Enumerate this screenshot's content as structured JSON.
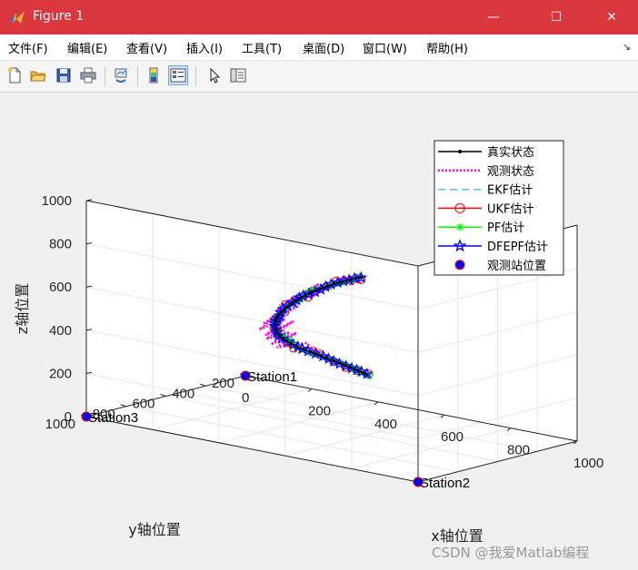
{
  "window": {
    "title": "Figure 1",
    "controls": {
      "minimize": "—",
      "maximize": "☐",
      "close": "✕"
    }
  },
  "menu": {
    "items": [
      "文件(F)",
      "编辑(E)",
      "查看(V)",
      "插入(I)",
      "工具(T)",
      "桌面(D)",
      "窗口(W)",
      "帮助(H)"
    ],
    "overflow": "↘"
  },
  "toolbar": {
    "buttons": [
      "new-figure",
      "open-file",
      "save-figure",
      "print-figure",
      "link-plot",
      "insert-colorbar",
      "insert-legend",
      "edit-plot",
      "open-property-inspector"
    ],
    "active": "insert-legend"
  },
  "colors": {
    "titlebar": "#d9363e",
    "truth": "#000000",
    "observation": "#ff00ff",
    "ekf": "#4dbeee",
    "ukf": "#ff0000",
    "pf": "#00ff00",
    "dfepf": "#0000ff",
    "station": "#0000ff",
    "station_edge": "#ff0000"
  },
  "chart_data": {
    "type": "line",
    "projection": "3d",
    "xlabel": "x轴位置",
    "ylabel": "y轴位置",
    "zlabel": "z轴位置",
    "xlim": [
      0,
      1000
    ],
    "ylim": [
      200,
      1000
    ],
    "zlim": [
      0,
      1000
    ],
    "xticks": [
      "0",
      "200",
      "400",
      "600",
      "800",
      "1000"
    ],
    "yticks": [
      "200",
      "400",
      "600",
      "800",
      "1000"
    ],
    "zticks": [
      "0",
      "200",
      "400",
      "600",
      "800",
      "1000"
    ],
    "grid": true,
    "legend_position": "top-right",
    "legend": [
      {
        "label": "真实状态",
        "color": "#000000",
        "style": "solid",
        "marker": "dot"
      },
      {
        "label": "观测状态",
        "color": "#ff00ff",
        "style": "dotted",
        "marker": "none"
      },
      {
        "label": "EKF估计",
        "color": "#4dbeee",
        "style": "dashed",
        "marker": "none"
      },
      {
        "label": "UKF估计",
        "color": "#ff0000",
        "style": "solid",
        "marker": "circle"
      },
      {
        "label": "PF估计",
        "color": "#00ff00",
        "style": "solid",
        "marker": "star"
      },
      {
        "label": "DFEPF估计",
        "color": "#0000ff",
        "style": "solid",
        "marker": "pentagram"
      },
      {
        "label": "观测站位置",
        "color": "#0000ff",
        "style": "none",
        "marker": "filled-circle"
      }
    ],
    "stations": [
      {
        "label": "Station1",
        "x": 0,
        "y": 200,
        "z": 0
      },
      {
        "label": "Station2",
        "x": 1000,
        "y": 1000,
        "z": 0
      },
      {
        "label": "Station3",
        "x": 0,
        "y": 1000,
        "z": 0
      }
    ],
    "trajectory_true": {
      "x": [
        370,
        360,
        348,
        335,
        323,
        311,
        299,
        287,
        276,
        265,
        255,
        245,
        236,
        229,
        224,
        221,
        221,
        224,
        230,
        238,
        248,
        260,
        274,
        289,
        305,
        322,
        340,
        359,
        379,
        399,
        420,
        441,
        462,
        484,
        506,
        528,
        550,
        572,
        594,
        616,
        638
      ],
      "y": [
        206,
        212,
        219,
        226,
        234,
        243,
        253,
        264,
        276,
        289,
        303,
        318,
        333,
        349,
        365,
        381,
        398,
        415,
        432,
        449,
        465,
        481,
        497,
        512,
        527,
        541,
        555,
        568,
        580,
        592,
        603,
        613,
        623,
        632,
        640,
        648,
        655,
        662,
        668,
        674,
        680
      ],
      "z": [
        118,
        127,
        135,
        144,
        153,
        162,
        171,
        181,
        191,
        202,
        213,
        225,
        238,
        252,
        267,
        283,
        300,
        318,
        337,
        357,
        378,
        399,
        421,
        443,
        465,
        487,
        509,
        531,
        552,
        573,
        593,
        613,
        632,
        651,
        669,
        686,
        703,
        719,
        734,
        749,
        762
      ]
    },
    "observation_offsets": {
      "x": [
        -5,
        15,
        -10,
        20,
        -15,
        10,
        -20,
        25,
        -5,
        30,
        -25,
        15,
        35,
        -30,
        10,
        -15,
        25,
        -20,
        30,
        -10,
        20,
        -35,
        15,
        -25,
        40,
        -15,
        30,
        -30,
        20,
        -40,
        25,
        -15,
        45,
        -20,
        35,
        -25,
        15,
        -30,
        10,
        20,
        -10
      ],
      "y": [
        10,
        -15,
        20,
        -10,
        25,
        -20,
        15,
        -25,
        30,
        -15,
        20,
        -35,
        10,
        25,
        -30,
        35,
        -10,
        20,
        -40,
        30,
        -15,
        25,
        -35,
        40,
        -20,
        30,
        -45,
        25,
        -20,
        35,
        -30,
        40,
        -25,
        20,
        -35,
        30,
        -20,
        15,
        -25,
        10,
        5
      ],
      "z": [
        5,
        -10,
        15,
        -5,
        20,
        -15,
        10,
        -20,
        25,
        -10,
        15,
        -25,
        30,
        -20,
        35,
        -25,
        20,
        -30,
        40,
        -35,
        25,
        -45,
        50,
        -40,
        35,
        -30,
        45,
        -35,
        30,
        -40,
        55,
        -30,
        40,
        -45,
        50,
        -35,
        30,
        -40,
        25,
        -20,
        15
      ]
    }
  },
  "watermark": "CSDN @我爱Matlab编程"
}
